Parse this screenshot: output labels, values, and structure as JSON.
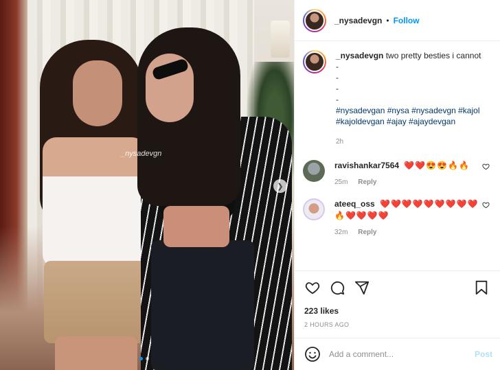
{
  "post": {
    "username": "_nysadevgn",
    "follow_label": "Follow",
    "separator": "•",
    "watermark": "_nysadevgn",
    "image_count": 2,
    "active_image": 1
  },
  "caption": {
    "username": "_nysadevgn",
    "text": "two pretty besties i cannot",
    "dashes": [
      "-",
      "-",
      "-",
      "-"
    ],
    "hashtags_line1": "#nysadevgan #nysa #nysadevgn #kajol",
    "hashtags_line2": "#kajoldevgan #ajay #ajaydevgan",
    "age": "2h"
  },
  "comments": [
    {
      "username": "ravishankar7564",
      "text": "❤️❤️😍😍🔥🔥",
      "age": "25m",
      "reply_label": "Reply"
    },
    {
      "username": "ateeq_oss",
      "text": "❤️❤️❤️❤️❤️❤️❤️❤️❤️🔥❤️❤️❤️❤️",
      "age": "32m",
      "reply_label": "Reply"
    }
  ],
  "stats": {
    "likes": "223 likes",
    "posted": "2 HOURS AGO"
  },
  "add_comment": {
    "placeholder": "Add a comment...",
    "post_label": "Post"
  },
  "colors": {
    "accent": "#0095f6",
    "link": "#00376b",
    "muted": "#8e8e8e",
    "post_disabled": "#b2dffc"
  },
  "icons": [
    "heart-icon",
    "comment-icon",
    "share-icon",
    "save-icon",
    "emoji-icon",
    "chevron-right-icon"
  ]
}
